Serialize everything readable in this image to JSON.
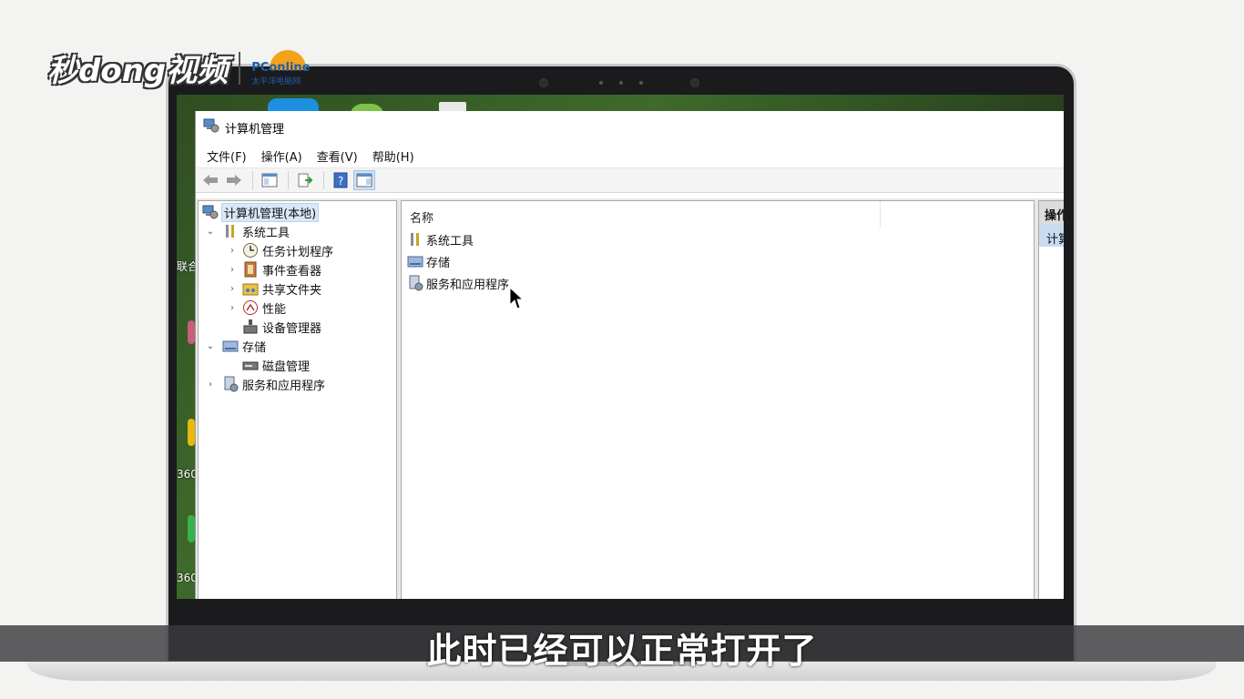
{
  "window": {
    "title": "计算机管理"
  },
  "menu": [
    "文件(F)",
    "操作(A)",
    "查看(V)",
    "帮助(H)"
  ],
  "tree": {
    "root": "计算机管理(本地)",
    "system_tools": "系统工具",
    "task_scheduler": "任务计划程序",
    "event_viewer": "事件查看器",
    "shared_folders": "共享文件夹",
    "performance": "性能",
    "device_manager": "设备管理器",
    "storage": "存储",
    "disk_management": "磁盘管理",
    "services_apps": "服务和应用程序"
  },
  "list": {
    "column_name": "名称",
    "items": [
      "系统工具",
      "存储",
      "服务和应用程序"
    ]
  },
  "actions": {
    "header": "操作",
    "item": "计算"
  },
  "desktop": {
    "labels": [
      "联合",
      "360",
      "360"
    ]
  },
  "overlay": {
    "subtitle": "此时已经可以正常打开了",
    "logo_text": "秒dong视频",
    "partner_logo": "PConline",
    "partner_sub": "太平洋电脑网"
  },
  "colors": {
    "selection": "#d9e7f7",
    "action_selected": "#c8dcf1",
    "wallpaper": "#3e6a2b"
  }
}
